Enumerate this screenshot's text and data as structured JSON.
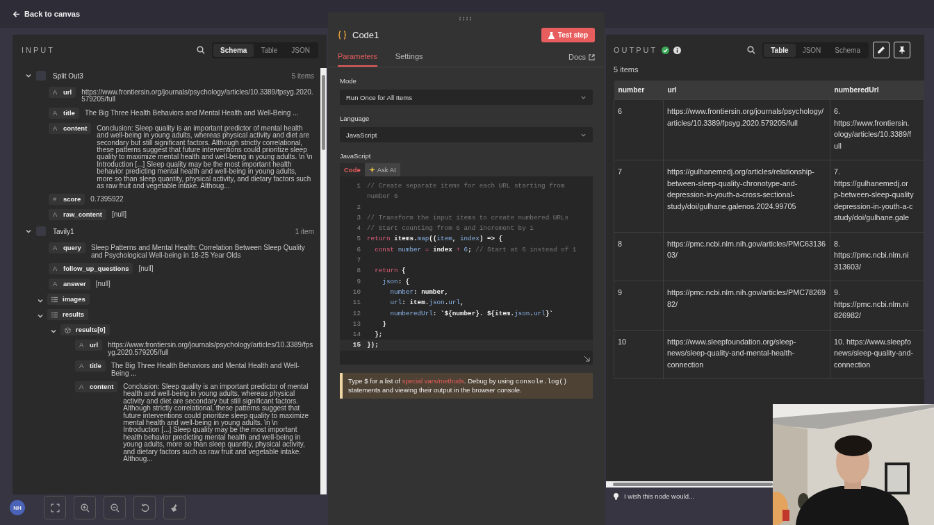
{
  "back_link": "Back to canvas",
  "avatar": "NH",
  "input": {
    "title": "INPUT",
    "view_tabs": [
      {
        "label": "Schema",
        "selected": true
      },
      {
        "label": "Table",
        "selected": false
      },
      {
        "label": "JSON",
        "selected": false
      }
    ],
    "nodes": [
      {
        "name": "Split Out3",
        "count": "5 items",
        "expanded": true,
        "fields": [
          {
            "kind": "string",
            "glyph": "A",
            "key": "url",
            "value": "https://www.frontiersin.org/journals/psychology/articles/10.3389/fpsyg.2020.579205/full"
          },
          {
            "kind": "string",
            "glyph": "A",
            "key": "title",
            "value": "The Big Three Health Behaviors and Mental Health and Well-Being ..."
          },
          {
            "kind": "string",
            "glyph": "A",
            "key": "content",
            "value": "Conclusion: Sleep quality is an important predictor of mental health and well-being in young adults, whereas physical activity and diet are secondary but still significant factors. Although strictly correlational, these patterns suggest that future interventions could prioritize sleep quality to maximize mental health and well-being in young adults. \\n \\n Introduction [...] Sleep quality may be the most important health behavior predicting mental health and well-being in young adults, more so than sleep quantity, physical activity, and dietary factors such as raw fruit and vegetable intake. Althoug..."
          },
          {
            "kind": "number",
            "glyph": "#",
            "key": "score",
            "value": "0.7395922"
          },
          {
            "kind": "string",
            "glyph": "A",
            "key": "raw_content",
            "value": "[null]"
          }
        ]
      },
      {
        "name": "Tavily1",
        "count": "1 item",
        "expanded": true,
        "fields": [
          {
            "kind": "string",
            "glyph": "A",
            "key": "query",
            "value": "Sleep Patterns and Mental Health: Correlation Between Sleep Quality and Psychological Well-being in 18-25 Year Olds"
          },
          {
            "kind": "string",
            "glyph": "A",
            "key": "follow_up_questions",
            "value": "[null]"
          },
          {
            "kind": "string",
            "glyph": "A",
            "key": "answer",
            "value": "[null]"
          },
          {
            "kind": "array",
            "key": "images",
            "expanded": true
          },
          {
            "kind": "array",
            "key": "results",
            "expanded": true,
            "children": [
              {
                "kind": "object",
                "key": "results[0]",
                "expanded": true,
                "children": [
                  {
                    "kind": "string",
                    "glyph": "A",
                    "key": "url",
                    "value": "https://www.frontiersin.org/journals/psychology/articles/10.3389/fpsyg.2020.579205/full"
                  },
                  {
                    "kind": "string",
                    "glyph": "A",
                    "key": "title",
                    "value": "The Big Three Health Behaviors and Mental Health and Well-Being ..."
                  },
                  {
                    "kind": "string",
                    "glyph": "A",
                    "key": "content",
                    "value": "Conclusion: Sleep quality is an important predictor of mental health and well-being in young adults, whereas physical activity and diet are secondary but still significant factors. Although strictly correlational, these patterns suggest that future interventions could prioritize sleep quality to maximize mental health and well-being in young adults. \\n \\n Introduction [...] Sleep quality may be the most important health behavior predicting mental health and well-being in young adults, more so than sleep quantity, physical activity, and dietary factors such as raw fruit and vegetable intake. Althoug..."
                  }
                ]
              }
            ]
          }
        ]
      }
    ]
  },
  "editor": {
    "title": "Code1",
    "test_button": "Test step",
    "tabs": [
      {
        "label": "Parameters",
        "selected": true
      },
      {
        "label": "Settings",
        "selected": false
      }
    ],
    "docs_link": "Docs",
    "mode": {
      "label": "Mode",
      "value": "Run Once for All Items"
    },
    "language": {
      "label": "Language",
      "value": "JavaScript"
    },
    "code_label": "JavaScript",
    "code_tabs": [
      {
        "label": "Code",
        "selected": true,
        "kind": "code"
      },
      {
        "label": "Ask AI",
        "selected": false,
        "kind": "ai"
      }
    ],
    "code_lines": [
      {
        "number": "1",
        "active": false,
        "tokens": [
          {
            "kind": "comment",
            "s": "// Create separate items for each URL starting from number 6"
          }
        ]
      },
      {
        "number": "2",
        "active": false
      },
      {
        "number": "3",
        "active": false,
        "tokens": [
          {
            "kind": "comment",
            "s": "// Transform the input items to create numbered URLs"
          }
        ]
      },
      {
        "number": "4",
        "active": false,
        "tokens": [
          {
            "kind": "comment",
            "s": "// Start counting from 6 and increment by 1"
          }
        ]
      },
      {
        "number": "5",
        "active": false,
        "tokens": [
          {
            "kind": "keyword",
            "s": "return"
          },
          {
            "kind": "plain",
            "s": " items."
          },
          {
            "kind": "prop",
            "s": "map"
          },
          {
            "kind": "plain",
            "s": "(("
          },
          {
            "kind": "prop",
            "s": "item"
          },
          {
            "kind": "plain",
            "s": ", "
          },
          {
            "kind": "prop",
            "s": "index"
          },
          {
            "kind": "plain",
            "s": ") => {"
          }
        ]
      },
      {
        "number": "6",
        "active": false,
        "tokens": [
          {
            "kind": "keyword",
            "s": "  const"
          },
          {
            "kind": "prop",
            "s": " number"
          },
          {
            "kind": "keyword",
            "s": " ="
          },
          {
            "kind": "plain",
            "s": " index"
          },
          {
            "kind": "keyword",
            "s": " +"
          },
          {
            "kind": "prop",
            "s": " 6"
          },
          {
            "kind": "plain",
            "s": ";"
          },
          {
            "kind": "comment",
            "s": " // Start at 6 instead of 1"
          }
        ]
      },
      {
        "number": "7",
        "active": false
      },
      {
        "number": "8",
        "active": false,
        "tokens": [
          {
            "kind": "keyword",
            "s": "  return"
          },
          {
            "kind": "plain",
            "s": " {"
          }
        ]
      },
      {
        "number": "9",
        "active": false,
        "tokens": [
          {
            "kind": "prop",
            "s": "    json"
          },
          {
            "kind": "plain",
            "s": ": {"
          }
        ]
      },
      {
        "number": "10",
        "active": false,
        "tokens": [
          {
            "kind": "prop",
            "s": "      number"
          },
          {
            "kind": "plain",
            "s": ": number,"
          }
        ]
      },
      {
        "number": "11",
        "active": false,
        "tokens": [
          {
            "kind": "prop",
            "s": "      url"
          },
          {
            "kind": "plain",
            "s": ": item."
          },
          {
            "kind": "prop",
            "s": "json"
          },
          {
            "kind": "plain",
            "s": "."
          },
          {
            "kind": "prop",
            "s": "url"
          },
          {
            "kind": "plain",
            "s": ","
          }
        ]
      },
      {
        "number": "12",
        "active": false,
        "tokens": [
          {
            "kind": "prop",
            "s": "      numberedUrl"
          },
          {
            "kind": "plain",
            "s": ": `${number}. ${item."
          },
          {
            "kind": "prop",
            "s": "json"
          },
          {
            "kind": "plain",
            "s": "."
          },
          {
            "kind": "prop",
            "s": "url"
          },
          {
            "kind": "plain",
            "s": "}`"
          }
        ]
      },
      {
        "number": "13",
        "active": false,
        "tokens": [
          {
            "kind": "plain",
            "s": "    }"
          }
        ]
      },
      {
        "number": "14",
        "active": false,
        "tokens": [
          {
            "kind": "plain",
            "s": "  };"
          }
        ]
      },
      {
        "number": "15",
        "active": true,
        "tokens": [
          {
            "kind": "plain",
            "s": "});"
          }
        ]
      }
    ],
    "hint": {
      "before": "Type $ for a list of ",
      "link": "special vars/methods",
      "middle": ". Debug by using ",
      "code": "console.log()",
      "after": " statements and viewing their output in the browser console."
    }
  },
  "output": {
    "title": "OUTPUT",
    "view_tabs": [
      {
        "label": "Table",
        "selected": true
      },
      {
        "label": "JSON",
        "selected": false
      },
      {
        "label": "Schema",
        "selected": false
      }
    ],
    "count": "5 items",
    "table": {
      "columns": [
        "number",
        "url",
        "numberedUrl"
      ],
      "rows": [
        [
          "6",
          "https://www.frontiersin.org/journals/psychology/articles/10.3389/fpsyg.2020.579205/full",
          "6.\nhttps://www.frontiersin.\nology/articles/10.3389/f\null"
        ],
        [
          "7",
          "https://gulhanemedj.org/articles/relationship-between-sleep-quality-chronotype-and-depression-in-youth-a-cross-sectional-study/doi/gulhane.galenos.2024.99705",
          "7.\nhttps://gulhanemedj.or\np-between-sleep-quality\ndepression-in-youth-a-c\nstudy/doi/gulhane.gale"
        ],
        [
          "8",
          "https://pmc.ncbi.nlm.nih.gov/articles/PMC6313603/",
          "8.\nhttps://pmc.ncbi.nlm.ni\n313603/"
        ],
        [
          "9",
          "https://pmc.ncbi.nlm.nih.gov/articles/PMC7826982/",
          "9.\nhttps://pmc.ncbi.nlm.ni\n826982/"
        ],
        [
          "10",
          "https://www.sleepfoundation.org/sleep-news/sleep-quality-and-mental-health-connection",
          "10. https://www.sleepfo\nnews/sleep-quality-and-\nconnection"
        ]
      ]
    },
    "feedback": "I wish this node would..."
  }
}
